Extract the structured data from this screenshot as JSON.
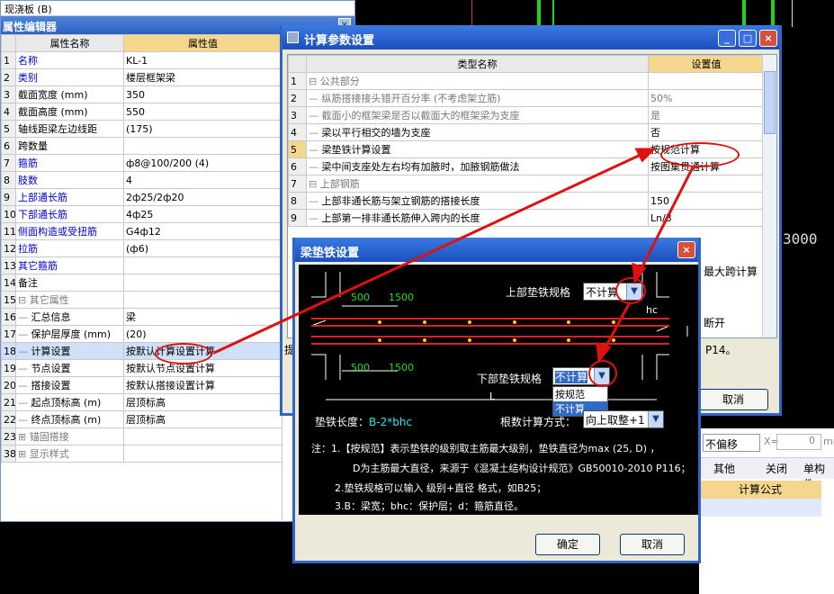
{
  "cad": {
    "big_text": "3000"
  },
  "prop_editor": {
    "top_item": "现浇板 (B)",
    "title": "属性编辑器",
    "close": "×",
    "col_name": "属性名称",
    "col_value": "属性值",
    "rows": [
      {
        "n": "1",
        "name": "名称",
        "value": "KL-1"
      },
      {
        "n": "2",
        "name": "类别",
        "value": "楼层框架梁"
      },
      {
        "n": "3",
        "name": "截面宽度 (mm)",
        "value": "350"
      },
      {
        "n": "4",
        "name": "截面高度 (mm)",
        "value": "550"
      },
      {
        "n": "5",
        "name": "轴线距梁左边线距",
        "value": "(175)"
      },
      {
        "n": "6",
        "name": "跨数量",
        "value": ""
      },
      {
        "n": "7",
        "name": "箍筋",
        "value": "ф8@100/200 (4)"
      },
      {
        "n": "8",
        "name": "肢数",
        "value": "4"
      },
      {
        "n": "9",
        "name": "上部通长筋",
        "value": "2ф25/2ф20"
      },
      {
        "n": "10",
        "name": "下部通长筋",
        "value": "4ф25"
      },
      {
        "n": "11",
        "name": "侧面构造或受扭筋",
        "value": "G4ф12"
      },
      {
        "n": "12",
        "name": "拉筋",
        "value": "(ф6)"
      },
      {
        "n": "13",
        "name": "其它箍筋",
        "value": ""
      },
      {
        "n": "14",
        "name": "备注",
        "value": ""
      },
      {
        "n": "15",
        "name": "其它属性",
        "value": ""
      },
      {
        "n": "16",
        "name": "汇总信息",
        "value": "梁"
      },
      {
        "n": "17",
        "name": "保护层厚度 (mm)",
        "value": "(20)"
      },
      {
        "n": "18",
        "name": "计算设置",
        "value": "按默认计算设置计算"
      },
      {
        "n": "19",
        "name": "节点设置",
        "value": "按默认节点设置计算"
      },
      {
        "n": "20",
        "name": "搭接设置",
        "value": "按默认搭接设置计算"
      },
      {
        "n": "21",
        "name": "起点顶标高 (m)",
        "value": "层顶标高"
      },
      {
        "n": "22",
        "name": "终点顶标高 (m)",
        "value": "层顶标高"
      },
      {
        "n": "23",
        "name": "锚固搭接",
        "value": ""
      },
      {
        "n": "38",
        "name": "显示样式",
        "value": ""
      }
    ]
  },
  "calc_dialog": {
    "title": "计算参数设置",
    "col_name": "类型名称",
    "col_value": "设置值",
    "rows": [
      {
        "n": "1",
        "name": "公共部分",
        "value": ""
      },
      {
        "n": "2",
        "name": "纵筋搭接接头错开百分率 (不考虑架立筋)",
        "value": "50%"
      },
      {
        "n": "3",
        "name": "截面小的框架梁是否以截面大的框架梁为支座",
        "value": "是"
      },
      {
        "n": "4",
        "name": "梁以平行相交的墙为支座",
        "value": "否"
      },
      {
        "n": "5",
        "name": "梁垫铁计算设置",
        "value": "按规范计算"
      },
      {
        "n": "6",
        "name": "梁中间支座处左右均有加腋时，加腋钢筋做法",
        "value": "按图集贯通计算"
      },
      {
        "n": "7",
        "name": "上部钢筋",
        "value": ""
      },
      {
        "n": "8",
        "name": "上部非通长筋与架立钢筋的搭接长度",
        "value": "150"
      },
      {
        "n": "9",
        "name": "上部第一排非通长筋伸入跨内的长度",
        "value": "Ln/3"
      }
    ],
    "right_values": [
      "最大跨计算",
      "断开",
      "P14。"
    ],
    "prefix_label": "提",
    "cancel": "取消"
  },
  "shim_dialog": {
    "title": "梁垫铁设置",
    "close": "×",
    "dim1": "500",
    "dim2": "1500",
    "top_label": "上部垫铁规格",
    "top_value": "不计算",
    "hc_label": "hc",
    "bottom_label": "下部垫铁规格",
    "bottom_value": "不计算",
    "options": [
      "按规范",
      "不计算"
    ],
    "L_label": "L",
    "length_label": "垫铁长度：",
    "length_value": "B-2*bhc",
    "count_label": "根数计算方式：",
    "count_value": "向上取整+1",
    "note1": "注：1.【按规范】表示垫铁的级别取主筋最大级别，垫铁直径为max (25, D) ，",
    "note2": "D为主筋最大直径，来源于《混凝土结构设计规范》GB50010-2010 P116；",
    "note3": "2.垫铁规格可以输入 级别+直径 格式，如B25；",
    "note4": "3.B：梁宽；bhc：保护层；d：箍筋直径。",
    "ok": "确定",
    "cancel": "取消"
  },
  "right_panel": {
    "offset_label": "不偏移",
    "x_label": "X=",
    "x_value": "0",
    "mm": "mm",
    "other": "其他",
    "close": "关闭",
    "single": "单构件",
    "formula": "计算公式"
  }
}
